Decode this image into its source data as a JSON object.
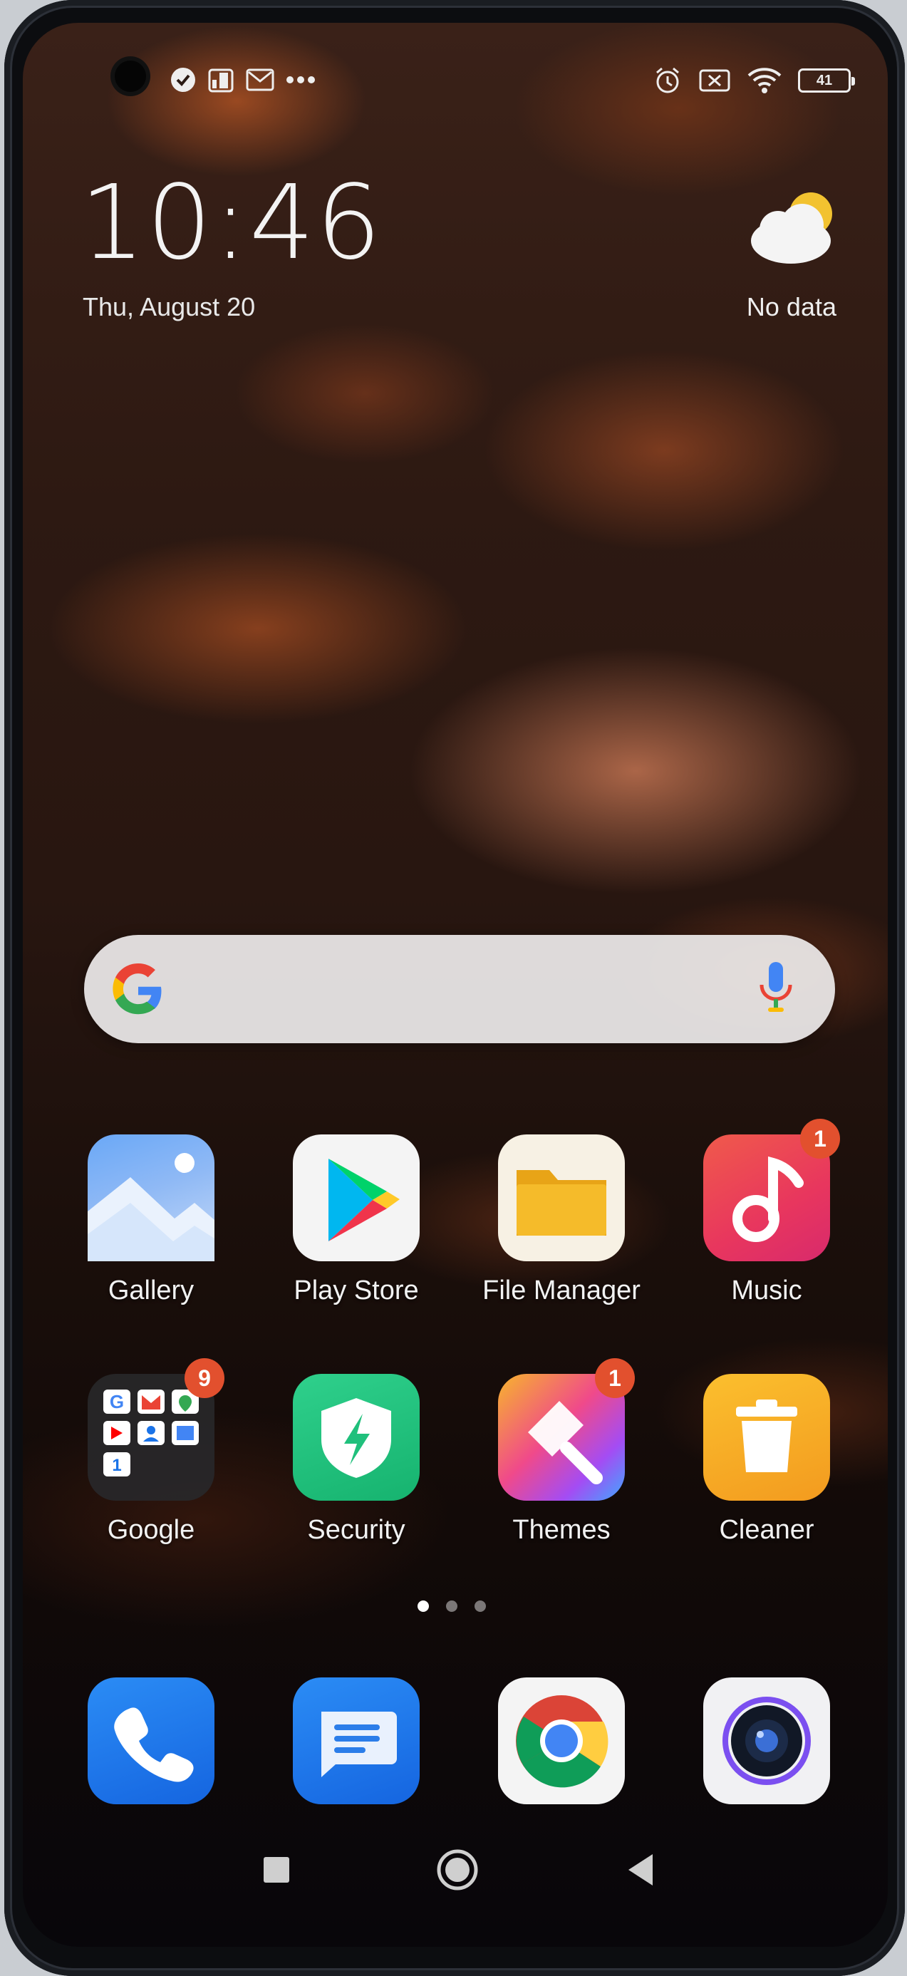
{
  "status_bar": {
    "left_icons": [
      "check-circle-icon",
      "notification-app-icon",
      "gmail-notification-icon",
      "more-notifications-icon"
    ],
    "right_icons": [
      "alarm-icon",
      "sim-off-icon",
      "wifi-icon"
    ],
    "battery_level": "41"
  },
  "clock_widget": {
    "time": "10:46",
    "date": "Thu, August 20"
  },
  "weather_widget": {
    "icon": "partly-cloudy-icon",
    "text": "No data"
  },
  "search_bar": {
    "logo": "google-g-icon",
    "mic": "microphone-icon"
  },
  "apps": [
    {
      "label": "Gallery",
      "icon": "gallery-icon"
    },
    {
      "label": "Play Store",
      "icon": "play-store-icon"
    },
    {
      "label": "File Manager",
      "icon": "folder-icon"
    },
    {
      "label": "Music",
      "icon": "music-note-icon",
      "badge": "1"
    },
    {
      "label": "Google",
      "icon": "google-folder-icon",
      "badge": "9"
    },
    {
      "label": "Security",
      "icon": "shield-icon"
    },
    {
      "label": "Themes",
      "icon": "paintbrush-icon",
      "badge": "1"
    },
    {
      "label": "Cleaner",
      "icon": "trash-icon"
    }
  ],
  "page_indicator": {
    "count": 3,
    "active": 1
  },
  "dock": [
    {
      "icon": "phone-icon"
    },
    {
      "icon": "messages-icon"
    },
    {
      "icon": "chrome-icon"
    },
    {
      "icon": "camera-icon"
    }
  ],
  "nav_bar": [
    "recents-square-icon",
    "home-circle-icon",
    "back-triangle-icon"
  ],
  "colors": {
    "badge": "#e2502e",
    "text": "#f2f2f2"
  }
}
